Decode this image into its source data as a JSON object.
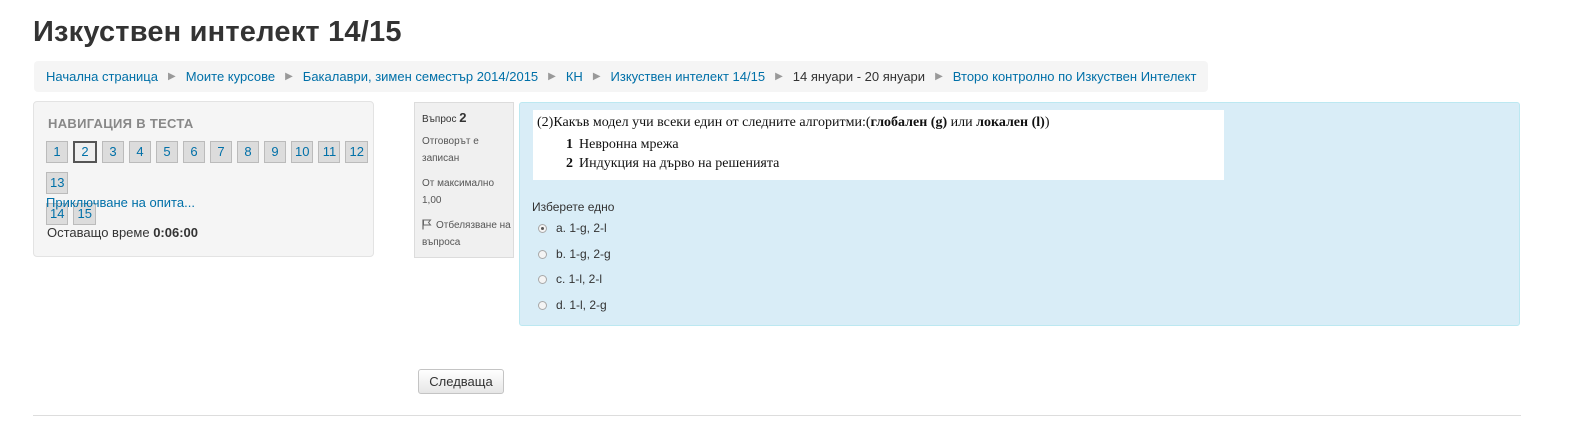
{
  "page": {
    "title": "Изкуствен интелект 14/15"
  },
  "breadcrumb": [
    {
      "label": "Начална страница",
      "link": true
    },
    {
      "label": "Моите курсове",
      "link": true
    },
    {
      "label": "Бакалаври, зимен семестър 2014/2015",
      "link": true
    },
    {
      "label": "КН",
      "link": true
    },
    {
      "label": "Изкуствен интелект 14/15",
      "link": true
    },
    {
      "label": "14 януари - 20 януари",
      "link": false
    },
    {
      "label": "Второ контролно по Изкуствен Интелект",
      "link": true
    }
  ],
  "quiz_nav": {
    "title": "НАВИГАЦИЯ В ТЕСТА",
    "buttons": [
      "1",
      "2",
      "3",
      "4",
      "5",
      "6",
      "7",
      "8",
      "9",
      "10",
      "11",
      "12",
      "13",
      "14",
      "15"
    ],
    "current": "2",
    "finish_link": "Приключване на опита...",
    "timer_label": "Оставащо време",
    "timer_value": "0:06:00"
  },
  "question_info": {
    "number_label": "Въпрос",
    "number": "2",
    "state": "Отговорът е записан",
    "grade": "От максимално 1,00",
    "flag": "Отбелязване на въпроса"
  },
  "question": {
    "text_prefix": "(2)Какъв модел учи всеки един от следните алгоритми:(",
    "bold1": "глобален (g)",
    "text_mid": " или ",
    "bold2": "локален (l)",
    "text_suffix": ")",
    "items": [
      {
        "num": "1",
        "text": "Невронна мрежа"
      },
      {
        "num": "2",
        "text": "Индукция на дърво на решенията"
      }
    ],
    "prompt": "Изберете едно",
    "options": [
      {
        "label": "a. 1-g, 2-l",
        "checked": true
      },
      {
        "label": "b. 1-g, 2-g",
        "checked": false
      },
      {
        "label": "c. 1-l, 2-l",
        "checked": false
      },
      {
        "label": "d. 1-l, 2-g",
        "checked": false
      }
    ]
  },
  "next_button": "Следваща"
}
